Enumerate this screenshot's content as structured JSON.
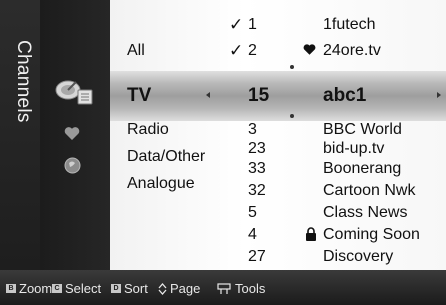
{
  "side_title": "Channels",
  "categories": [
    "All",
    "TV",
    "Radio",
    "Data/Other",
    "Analogue"
  ],
  "favorite_rows": [
    {
      "mark": "✓",
      "number": "1",
      "name": "1futech"
    },
    {
      "mark": "✓",
      "number": "2",
      "name": "24ore.tv"
    }
  ],
  "selected_row": {
    "number": "15",
    "name": "abc1"
  },
  "channel_rows": [
    {
      "number": "3",
      "name": "BBC World"
    },
    {
      "number": "23",
      "name": "bid-up.tv"
    },
    {
      "number": "33",
      "name": "Boonerang"
    },
    {
      "number": "32",
      "name": "Cartoon Nwk"
    },
    {
      "number": "5",
      "name": "Class News"
    },
    {
      "number": "4",
      "name": "Coming Soon"
    },
    {
      "number": "27",
      "name": "Discovery"
    }
  ],
  "bottom_bar": {
    "zoom_key": "B",
    "zoom": "Zoom",
    "select_key": "C",
    "select": "Select",
    "sort_key": "D",
    "sort": "Sort",
    "page": "Page",
    "tools": "Tools"
  },
  "colors": {
    "selected_band": "#a8a8a8",
    "panel": "#ffffff",
    "bar": "#1f1f1f"
  }
}
